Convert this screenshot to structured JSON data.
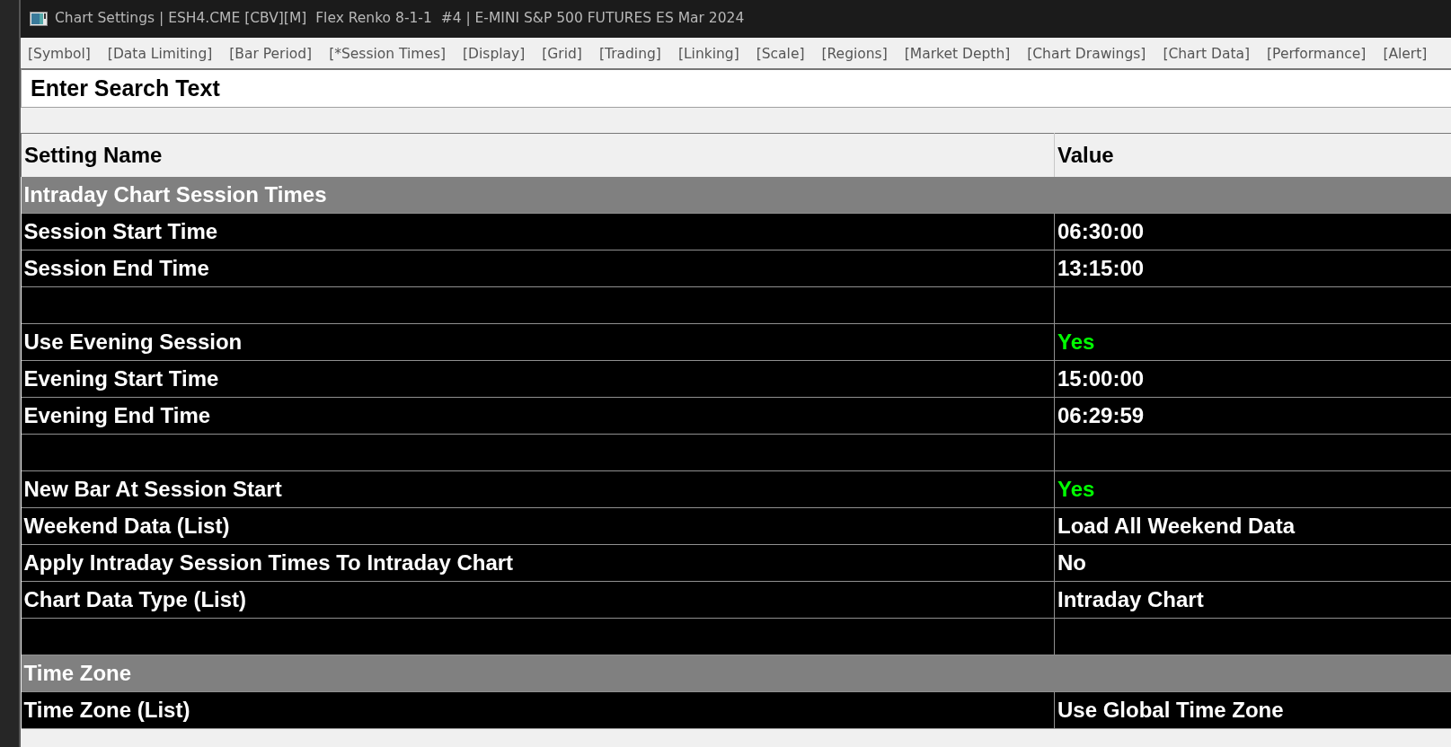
{
  "window": {
    "title": "Chart Settings | ESH4.CME [CBV][M]  Flex Renko 8-1-1  #4 | E-MINI S&P 500 FUTURES ES Mar 2024"
  },
  "tabs": [
    "[Symbol]",
    "[Data Limiting]",
    "[Bar Period]",
    "[*Session Times]",
    "[Display]",
    "[Grid]",
    "[Trading]",
    "[Linking]",
    "[Scale]",
    "[Regions]",
    "[Market Depth]",
    "[Chart Drawings]",
    "[Chart Data]",
    "[Performance]",
    "[Alert]"
  ],
  "search": {
    "placeholder": "Enter Search Text"
  },
  "table": {
    "columns": [
      "Setting Name",
      "Value"
    ],
    "rows": [
      {
        "kind": "group",
        "name": "Intraday Chart Session Times"
      },
      {
        "kind": "setting",
        "name": "Session Start Time",
        "value": "06:30:00"
      },
      {
        "kind": "setting",
        "name": "Session End Time",
        "value": "13:15:00"
      },
      {
        "kind": "blank"
      },
      {
        "kind": "setting",
        "name": "Use Evening Session",
        "value": "Yes",
        "color": "#00ff00"
      },
      {
        "kind": "setting",
        "name": "Evening Start Time",
        "value": "15:00:00"
      },
      {
        "kind": "setting",
        "name": "Evening End Time",
        "value": "06:29:59"
      },
      {
        "kind": "blank"
      },
      {
        "kind": "setting",
        "name": "New Bar At Session Start",
        "value": "Yes",
        "color": "#00ff00"
      },
      {
        "kind": "setting",
        "name": "Weekend Data (List)",
        "value": "Load All Weekend Data"
      },
      {
        "kind": "setting",
        "name": "Apply Intraday Session Times To Intraday Chart",
        "value": "No"
      },
      {
        "kind": "setting",
        "name": "Chart Data Type (List)",
        "value": "Intraday Chart"
      },
      {
        "kind": "blank"
      },
      {
        "kind": "group",
        "name": "Time Zone"
      },
      {
        "kind": "setting",
        "name": "Time Zone (List)",
        "value": "Use Global Time Zone"
      }
    ]
  }
}
